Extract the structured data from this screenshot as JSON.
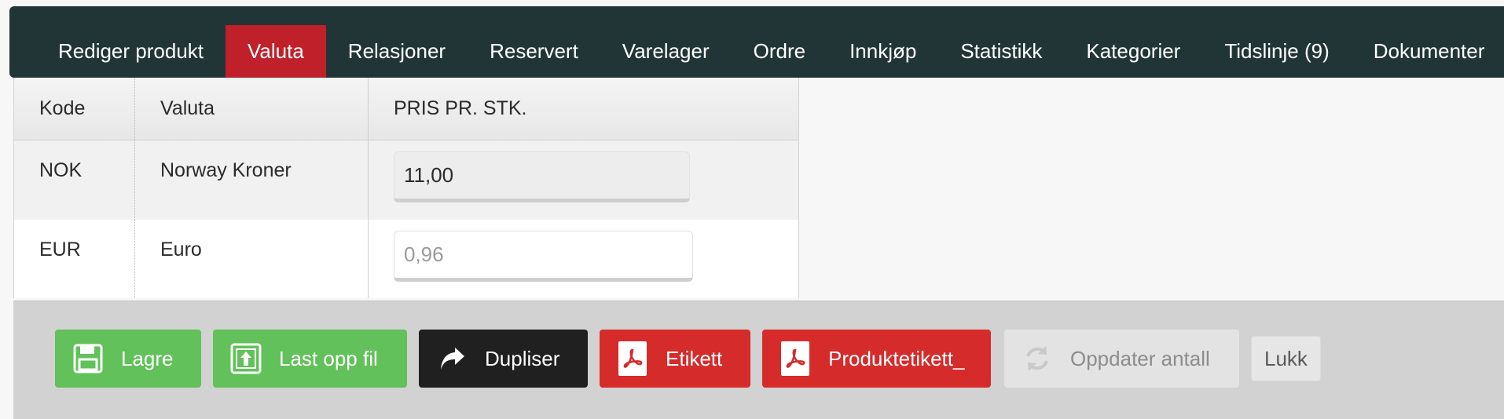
{
  "tabs": [
    {
      "label": "Rediger produkt",
      "active": false
    },
    {
      "label": "Valuta",
      "active": true
    },
    {
      "label": "Relasjoner",
      "active": false
    },
    {
      "label": "Reservert",
      "active": false
    },
    {
      "label": "Varelager",
      "active": false
    },
    {
      "label": "Ordre",
      "active": false
    },
    {
      "label": "Innkjøp",
      "active": false
    },
    {
      "label": "Statistikk",
      "active": false
    },
    {
      "label": "Kategorier",
      "active": false
    },
    {
      "label": "Tidslinje (9)",
      "active": false
    },
    {
      "label": "Dokumenter",
      "active": false
    }
  ],
  "table": {
    "columns": [
      "Kode",
      "Valuta",
      "PRIS PR. STK."
    ],
    "rows": [
      {
        "code": "NOK",
        "currency": "Norway Kroner",
        "price_value": "11,00",
        "price_placeholder": ""
      },
      {
        "code": "EUR",
        "currency": "Euro",
        "price_value": "",
        "price_placeholder": "0,96"
      }
    ]
  },
  "actions": {
    "save": {
      "label": "Lagre",
      "icon": "floppy-disk-icon"
    },
    "upload": {
      "label": "Last opp fil",
      "icon": "upload-icon"
    },
    "duplicate": {
      "label": "Dupliser",
      "icon": "share-arrow-icon"
    },
    "label": {
      "label": "Etikett",
      "icon": "pdf-icon"
    },
    "product_label": {
      "label": "Produktetikett_",
      "icon": "pdf-icon"
    },
    "update_qty": {
      "label": "Oppdater antall",
      "icon": "refresh-icon",
      "disabled": true
    },
    "close": {
      "label": "Lukk"
    }
  },
  "colors": {
    "tabbar": "#223536",
    "active_tab": "#c0202a",
    "green": "#62c15a",
    "red": "#d62b2b",
    "black": "#202020"
  }
}
